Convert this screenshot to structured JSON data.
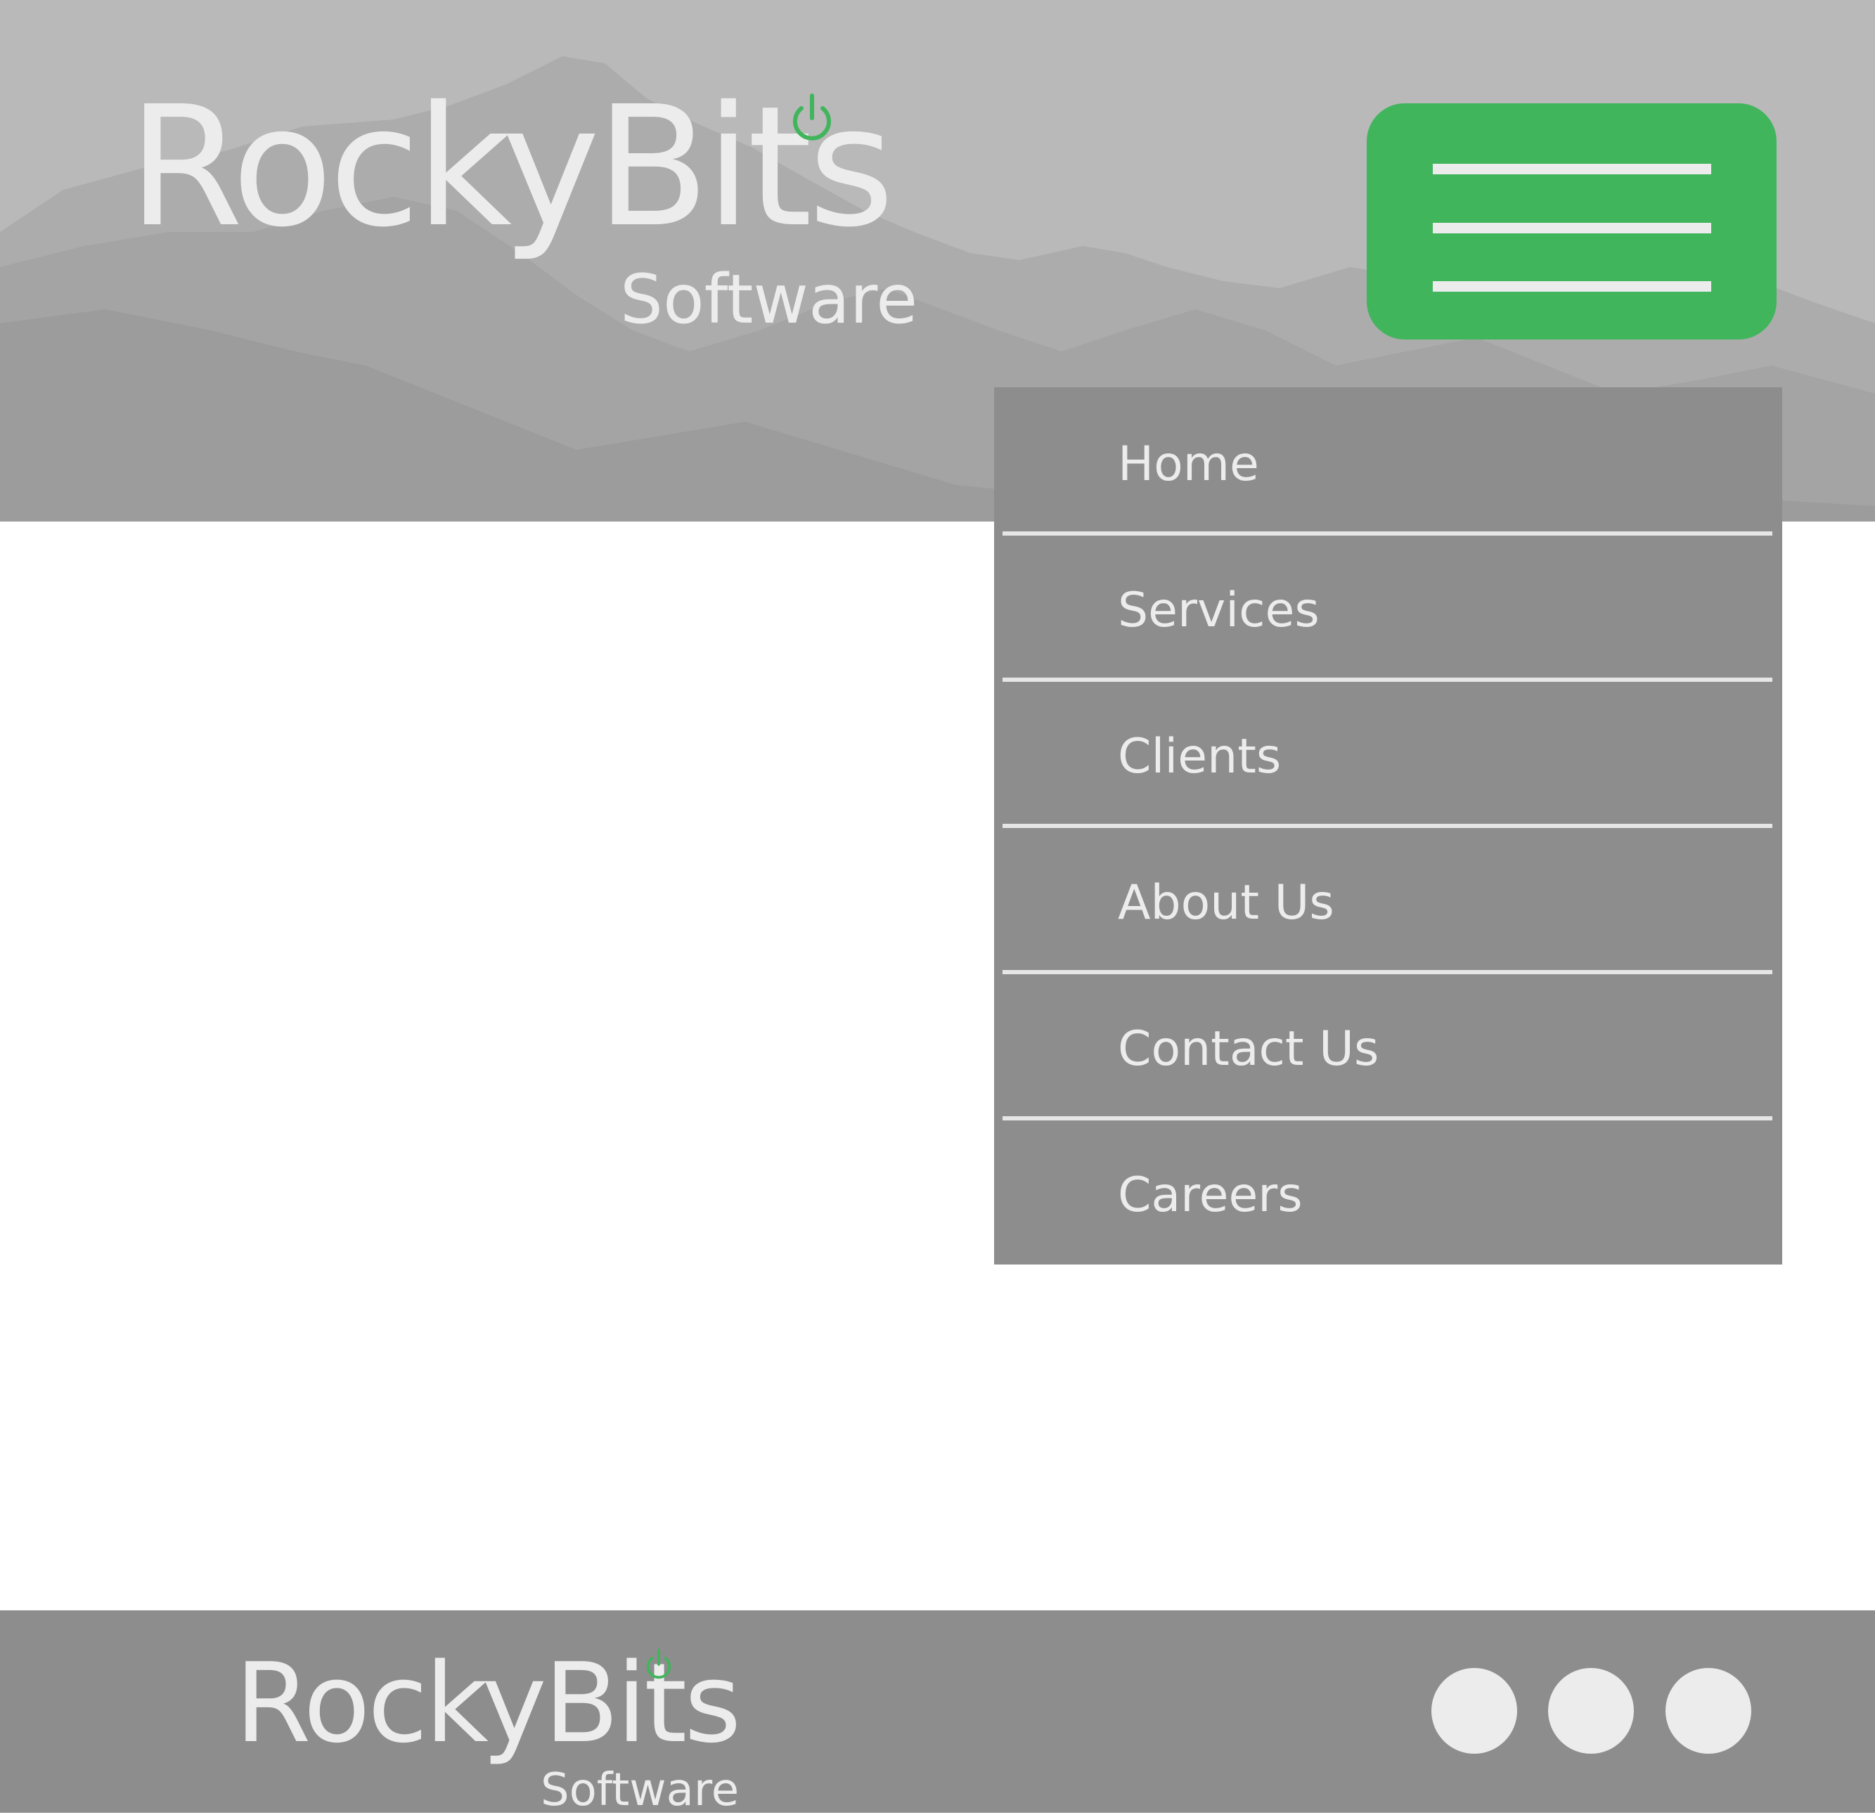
{
  "colors": {
    "accent": "#41b55c",
    "header_bg": "#b9b9b9",
    "menu_bg": "#8d8d8d",
    "footer_bg": "#8d8d8d",
    "text_light": "#ececec"
  },
  "brand": {
    "name": "RockyBits",
    "tagline": "Software",
    "icon": "power-icon"
  },
  "header": {
    "menu_toggle_icon": "hamburger-icon"
  },
  "menu": {
    "items": [
      {
        "label": "Home"
      },
      {
        "label": "Services"
      },
      {
        "label": "Clients"
      },
      {
        "label": "About Us"
      },
      {
        "label": "Contact Us"
      },
      {
        "label": "Careers"
      }
    ]
  },
  "footer": {
    "brand_name": "RockyBits",
    "brand_tagline": "Software",
    "social_links": [
      {
        "icon": "social-icon-1"
      },
      {
        "icon": "social-icon-2"
      },
      {
        "icon": "social-icon-3"
      }
    ]
  }
}
